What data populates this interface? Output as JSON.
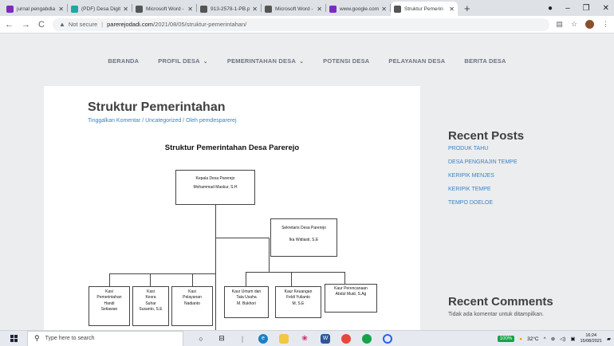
{
  "browser": {
    "tabs": [
      {
        "title": "jurnal pengabdia",
        "color": "#7b2cbf"
      },
      {
        "title": "(PDF) Desa Digita",
        "color": "#1fa7a2"
      },
      {
        "title": "Microsoft Word -",
        "color": "#555555"
      },
      {
        "title": "913-2578-1-PB.p",
        "color": "#555555"
      },
      {
        "title": "Microsoft Word -",
        "color": "#555555"
      },
      {
        "title": "www.google.com",
        "color": "#7b2cbf"
      },
      {
        "title": "Struktur Pemerin",
        "color": "#555555"
      }
    ],
    "address": {
      "security_label": "Not secure",
      "separator": "|",
      "domain": "parerejodadi.com",
      "path": "/2021/08/05/struktur-pemerintahan/"
    }
  },
  "site": {
    "nav": [
      {
        "label": "BERANDA",
        "dropdown": false
      },
      {
        "label": "PROFIL DESA",
        "dropdown": true
      },
      {
        "label": "PEMERINTAHAN DESA",
        "dropdown": true
      },
      {
        "label": "POTENSI DESA",
        "dropdown": false
      },
      {
        "label": "PELAYANAN DESA",
        "dropdown": false
      },
      {
        "label": "BERITA DESA",
        "dropdown": false
      }
    ]
  },
  "post": {
    "title": "Struktur Pemerintahan",
    "meta": "Tinggalkan Komentar / Uncategorized / Oleh pemdesparerej"
  },
  "org_chart": {
    "title": "Struktur Pemerintahan Desa Parerejo",
    "kepala": {
      "role": "Kepala Desa Parerejo",
      "name": "Mohammad Maskur, S.H"
    },
    "sekretaris": {
      "role": "Sekretaris Desa Parerejo",
      "name": "Ika Widiasti, S.E"
    },
    "kasi": [
      {
        "l1": "Kasi",
        "l2": "Pemerintahan",
        "l3": "Handi",
        "l4": "Setiawan"
      },
      {
        "l1": "Kasi",
        "l2": "Kesra",
        "l3": "Suhar",
        "l4": "Susanto, S.E"
      },
      {
        "l1": "Kasi",
        "l2": "Pelayanan",
        "l3": "Nadianto",
        "l4": ""
      }
    ],
    "kaur": [
      {
        "l1": "Kaur Umum dan",
        "l2": "Tata Usaha",
        "l3": "M. Bukhori"
      },
      {
        "l1": "Kaur Keuangan",
        "l2": "Feldi Yulianto",
        "l3": "M, S.E"
      },
      {
        "l1": "Kaur Perencanaan",
        "l2": "Abdul Muid, S.Ag",
        "l3": ""
      }
    ]
  },
  "sidebar": {
    "recent_posts_title": "Recent Posts",
    "recent_posts": [
      "PRODUK TAHU",
      "DESA PENGRAJIN TEMPE",
      "KERIPIK MENJES",
      "KERIPIK TEMPE",
      "TEMPO DOELOE"
    ],
    "recent_comments_title": "Recent Comments",
    "recent_comments_text": "Tidak ada komentar untuk ditampilkan."
  },
  "taskbar": {
    "search_placeholder": "Type here to search",
    "battery": "100%",
    "temperature": "32°C",
    "time": "16:24",
    "date": "15/08/2021"
  }
}
